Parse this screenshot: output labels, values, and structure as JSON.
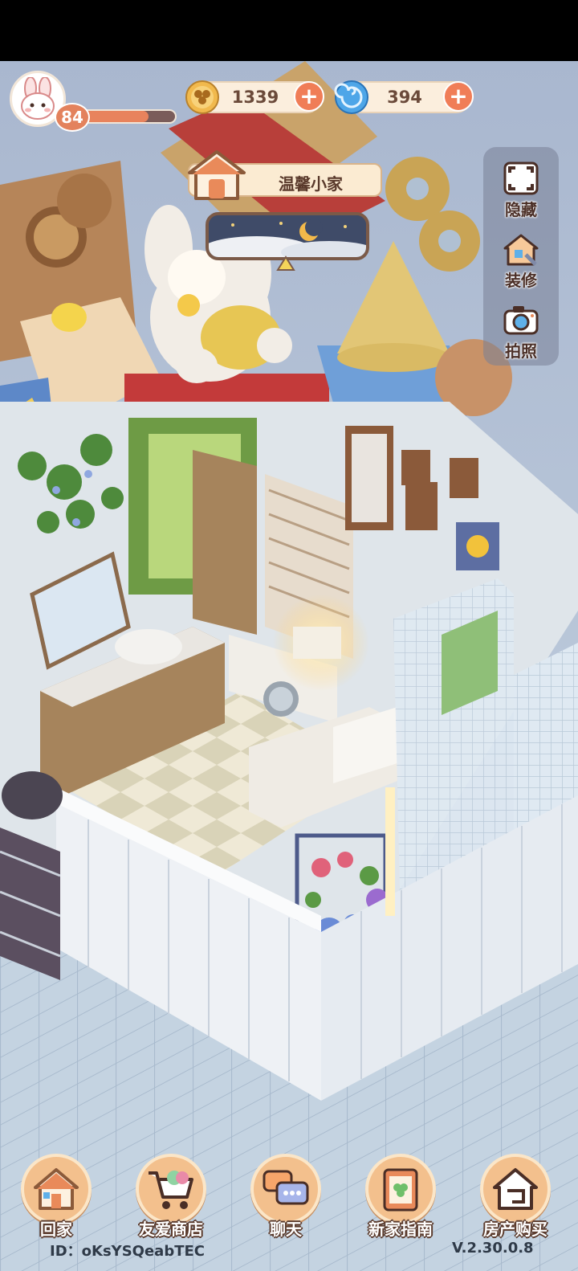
{
  "player": {
    "level": "84",
    "level_progress": 0.72,
    "avatar_icon": "bunny-avatar-icon"
  },
  "currencies": {
    "coins": {
      "value": "1339",
      "icon": "clover-coin-icon"
    },
    "gems": {
      "value": "394",
      "icon": "swirl-gem-icon"
    }
  },
  "home": {
    "title": "温馨小家",
    "icon": "house-icon"
  },
  "weather": {
    "icon": "night-moon-clouds-icon"
  },
  "side_menu": {
    "hide_label": "隐藏",
    "decorate_label": "装修",
    "photo_label": "拍照"
  },
  "bottom_nav": {
    "home_label": "回家",
    "shop_label": "友爱商店",
    "chat_label": "聊天",
    "guide_label": "新家指南",
    "buy_label": "房产购买"
  },
  "footer": {
    "user_id": "ID：oKsYSQeabTEC",
    "version": "V.2.30.0.8"
  },
  "colors": {
    "accent_orange": "#f07d57",
    "panel_cream": "#fbeedd",
    "wood_brown": "#7b5a48",
    "sky_blue": "#b7c7d8"
  }
}
